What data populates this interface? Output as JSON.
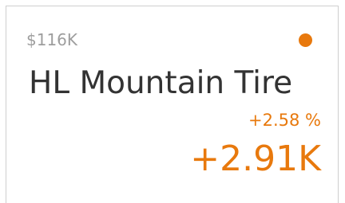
{
  "card": {
    "total_value": "$116K",
    "product_name": "HL Mountain Tire",
    "change_percent": "+2.58 %",
    "change_absolute": "+2.91K",
    "indicator": "status-dot",
    "accent_color": "#e8790d",
    "muted_color": "#9e9e9e",
    "title_color": "#333333"
  }
}
